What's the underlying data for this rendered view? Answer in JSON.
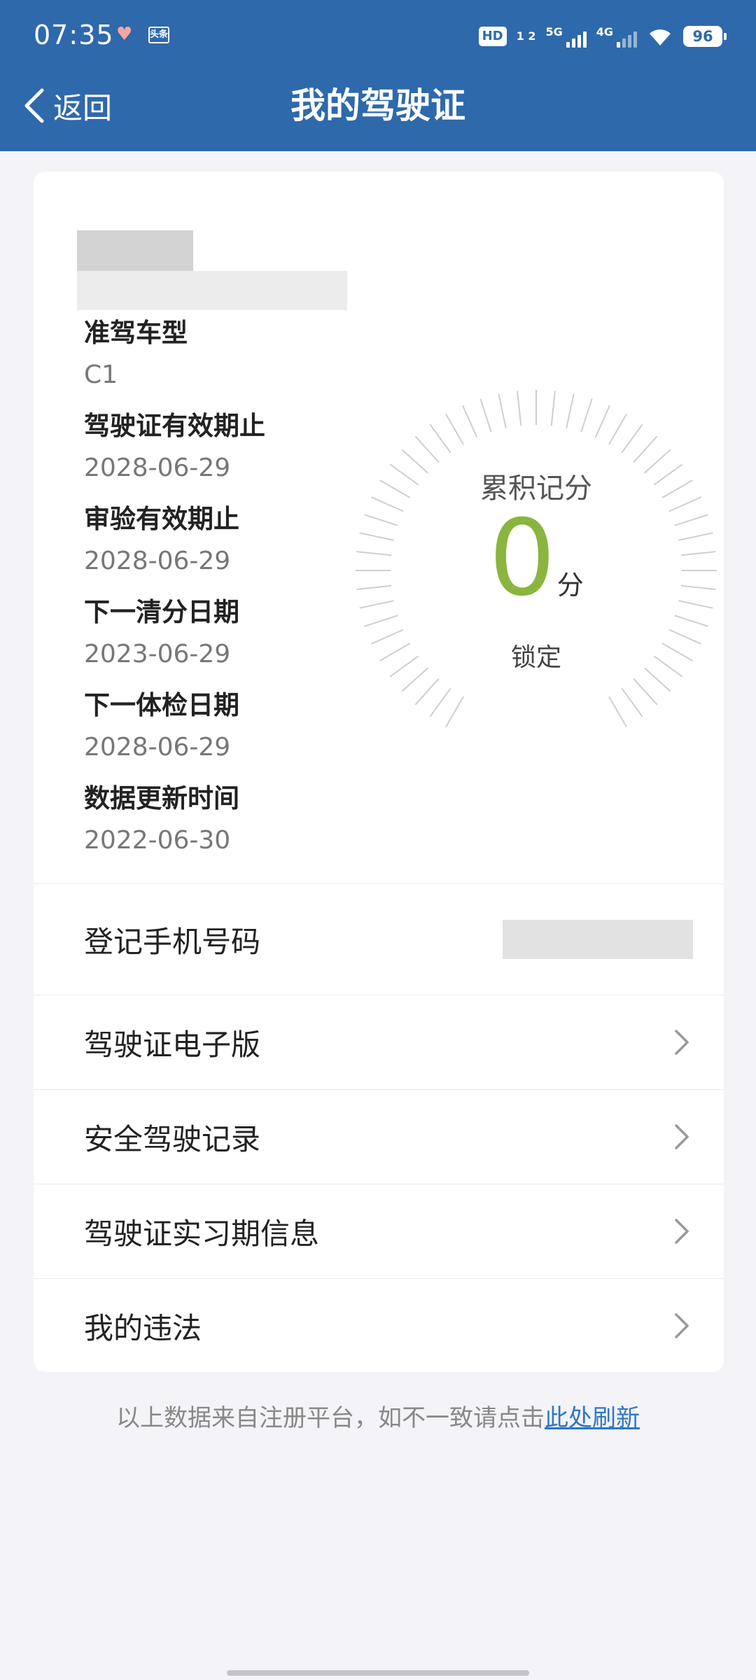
{
  "status_bar": {
    "time": "07:35",
    "app_badge": "头条",
    "hd_label": "HD",
    "hd_sub": "1 2",
    "network_1": "5G",
    "network_2": "4G",
    "battery": "96",
    "icons": [
      "heart-icon",
      "app-badge-icon",
      "hd-icon",
      "signal-icon",
      "wifi-icon",
      "battery-icon"
    ]
  },
  "nav": {
    "back_label": "返回",
    "title": "我的驾驶证"
  },
  "license_info": {
    "items": [
      {
        "label": "准驾车型",
        "value": "C1"
      },
      {
        "label": "驾驶证有效期止",
        "value": "2028-06-29"
      },
      {
        "label": "审验有效期止",
        "value": "2028-06-29"
      },
      {
        "label": "下一清分日期",
        "value": "2023-06-29"
      },
      {
        "label": "下一体检日期",
        "value": "2028-06-29"
      },
      {
        "label": "数据更新时间",
        "value": "2022-06-30"
      }
    ]
  },
  "score": {
    "title": "累积记分",
    "value": "0",
    "unit": "分",
    "status": "锁定",
    "accent_color": "#8ab53e"
  },
  "rows": {
    "phone_label": "登记手机号码",
    "items": [
      {
        "label": "驾驶证电子版"
      },
      {
        "label": "安全驾驶记录"
      },
      {
        "label": "驾驶证实习期信息"
      },
      {
        "label": "我的违法"
      }
    ]
  },
  "footer": {
    "note": "以上数据来自注册平台，如不一致请点击",
    "link": "此处刷新"
  },
  "colors": {
    "header": "#2e69ab",
    "background": "#f3f3f8",
    "link": "#2f76c6"
  }
}
